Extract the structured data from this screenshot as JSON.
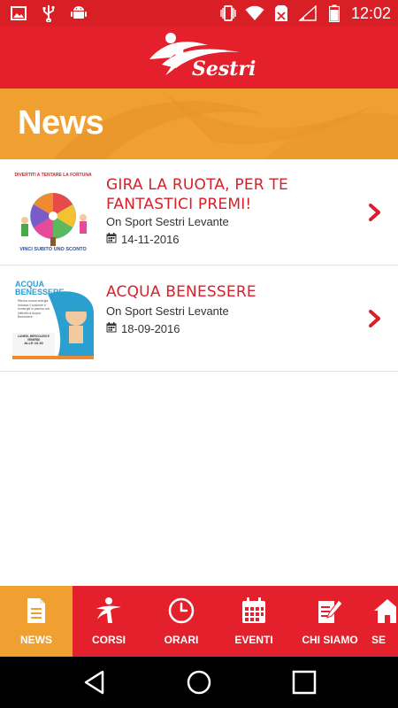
{
  "status_bar": {
    "time": "12:02",
    "left_icons": [
      "image-icon",
      "usb-icon",
      "android-icon"
    ],
    "right_icons": [
      "vibrate-icon",
      "wifi-icon",
      "no-sim-icon",
      "signal-icon",
      "battery-icon"
    ]
  },
  "header": {
    "logo_text": "Sestri"
  },
  "page": {
    "title": "News"
  },
  "news": [
    {
      "title": "GIRA LA RUOTA, PER TE FANTASTICI PREMI!",
      "source": "On Sport Sestri Levante",
      "date": "14-11-2016",
      "thumb": {
        "top_text": "DIVERTITI A TENTARE LA FORTUNA",
        "wheel_text": "SCONTI",
        "bottom_text": "VINCI SUBITO UNO SCONTO"
      }
    },
    {
      "title": "ACQUA BENESSERE",
      "source": "On Sport Sestri Levante",
      "date": "18-09-2016",
      "thumb": {
        "heading": "ACQUA BENESSERE",
        "body": "Ritrova nuova energia. Indossa il costume e immergiti in piscina con l'attività di Acqua Benessere.",
        "days": "LUNEDI, MERCOLEDI E VENERDI",
        "time": "ALLE 10.30"
      }
    }
  ],
  "bottom_nav": [
    {
      "label": "NEWS",
      "icon": "document-icon",
      "active": true
    },
    {
      "label": "CORSI",
      "icon": "person-running-icon",
      "active": false
    },
    {
      "label": "ORARI",
      "icon": "clock-icon",
      "active": false
    },
    {
      "label": "EVENTI",
      "icon": "calendar-icon",
      "active": false
    },
    {
      "label": "CHI SIAMO",
      "icon": "edit-document-icon",
      "active": false
    },
    {
      "label": "SE",
      "icon": "home-icon",
      "active": false
    }
  ],
  "colors": {
    "brand_red": "#e3202b",
    "accent_orange": "#f0a030",
    "title_red": "#d8202b"
  }
}
